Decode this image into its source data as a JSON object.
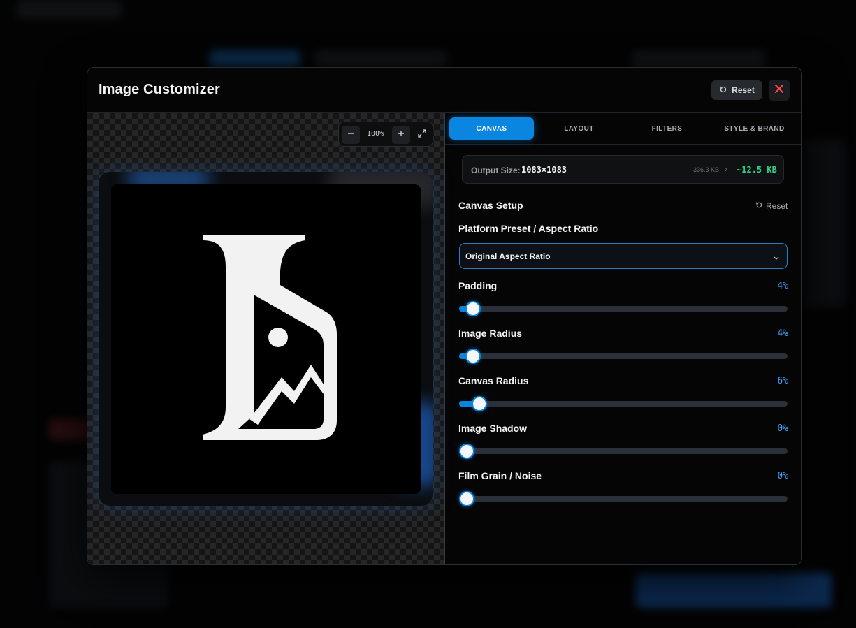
{
  "modal": {
    "title": "Image Customizer",
    "reset_label": "Reset"
  },
  "preview": {
    "zoom_level": "100%"
  },
  "tabs": [
    {
      "label": "CANVAS",
      "active": true
    },
    {
      "label": "LAYOUT",
      "active": false
    },
    {
      "label": "FILTERS",
      "active": false
    },
    {
      "label": "STYLE & BRAND",
      "active": false
    }
  ],
  "output": {
    "label": "Output Size:",
    "dimensions": "1083×1083",
    "original_size": "336.3 KB",
    "new_size": "~12.5 KB"
  },
  "canvas_setup": {
    "title": "Canvas Setup",
    "reset_label": "Reset",
    "preset_label": "Platform Preset / Aspect Ratio",
    "preset_value": "Original Aspect Ratio",
    "sliders": [
      {
        "label": "Padding",
        "value_text": "4%",
        "value": 4
      },
      {
        "label": "Image Radius",
        "value_text": "4%",
        "value": 4
      },
      {
        "label": "Canvas Radius",
        "value_text": "6%",
        "value": 6
      },
      {
        "label": "Image Shadow",
        "value_text": "0%",
        "value": 0
      },
      {
        "label": "Film Grain / Noise",
        "value_text": "0%",
        "value": 0
      }
    ]
  },
  "colors": {
    "accent": "#0a85e0",
    "value_text": "#41a3ff",
    "new_size": "#2fd08a",
    "close": "#ff4d4d"
  }
}
